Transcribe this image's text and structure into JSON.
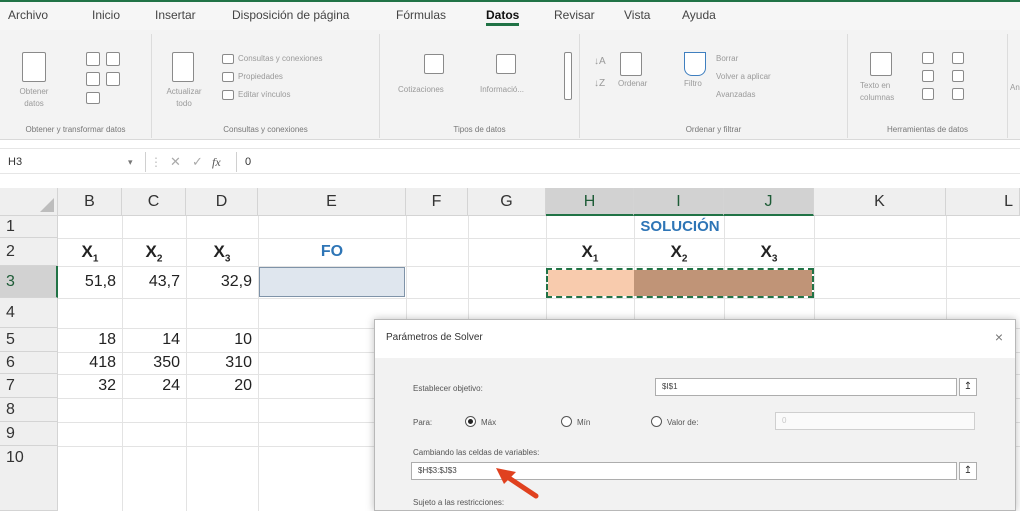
{
  "menu": {
    "tabs": [
      "Archivo",
      "Inicio",
      "Insertar",
      "Disposición de página",
      "Fórmulas",
      "Datos",
      "Revisar",
      "Vista",
      "Ayuda"
    ],
    "active": "Datos"
  },
  "ribbon": {
    "get_data": {
      "label": "Obtener datos",
      "group": "Obtener y transformar datos"
    },
    "queries": {
      "refresh": "Actualizar todo",
      "items": [
        "Consultas y conexiones",
        "Propiedades",
        "Editar vínculos"
      ],
      "group": "Consultas y conexiones"
    },
    "data_types": {
      "items": [
        "Cotizaciones",
        "Informació..."
      ],
      "group": "Tipos de datos"
    },
    "sort_filter": {
      "sort": "Ordenar",
      "filter": "Filtro",
      "items": [
        "Borrar",
        "Volver a aplicar",
        "Avanzadas"
      ],
      "group": "Ordenar y filtrar"
    },
    "data_tools": {
      "text_to_cols": "Texto en columnas",
      "group": "Herramientas de datos"
    },
    "cut_off": "Aná"
  },
  "formula_bar": {
    "name_box": "H3",
    "fx": "fx",
    "content": "0"
  },
  "grid": {
    "columns": [
      "B",
      "C",
      "D",
      "E",
      "F",
      "G",
      "H",
      "I",
      "J",
      "K",
      "L"
    ],
    "rows": [
      "1",
      "2",
      "3",
      "4",
      "5",
      "6",
      "7",
      "8",
      "9",
      "10"
    ],
    "solution_title": "SOLUCIÓN",
    "fo_label": "FO",
    "var_headers": [
      "X",
      "X",
      "X"
    ],
    "var_subs": [
      "1",
      "2",
      "3"
    ],
    "row3": [
      "51,8",
      "43,7",
      "32,9"
    ],
    "row5": [
      "18",
      "14",
      "10"
    ],
    "row6": [
      "418",
      "350",
      "310"
    ],
    "row7": [
      "32",
      "24",
      "20"
    ]
  },
  "solver": {
    "title": "Parámetros de Solver",
    "close": "×",
    "objective_label": "Establecer objetivo:",
    "objective_value": "$I$1",
    "to_label": "Para:",
    "options": [
      "Máx",
      "Mín",
      "Valor de:"
    ],
    "selected": "Máx",
    "value_of": "0",
    "changing_label": "Cambiando las celdas de variables:",
    "changing_value": "$H$3:$J$3",
    "constraints_label": "Sujeto a las restricciones:",
    "collapse_icon": "↥"
  },
  "colors": {
    "excel_green": "#217346",
    "accent_blue": "#2e75b6",
    "h3_fill": "#f8cbad",
    "ij_fill": "#c09477",
    "arrow": "#e0411f"
  }
}
